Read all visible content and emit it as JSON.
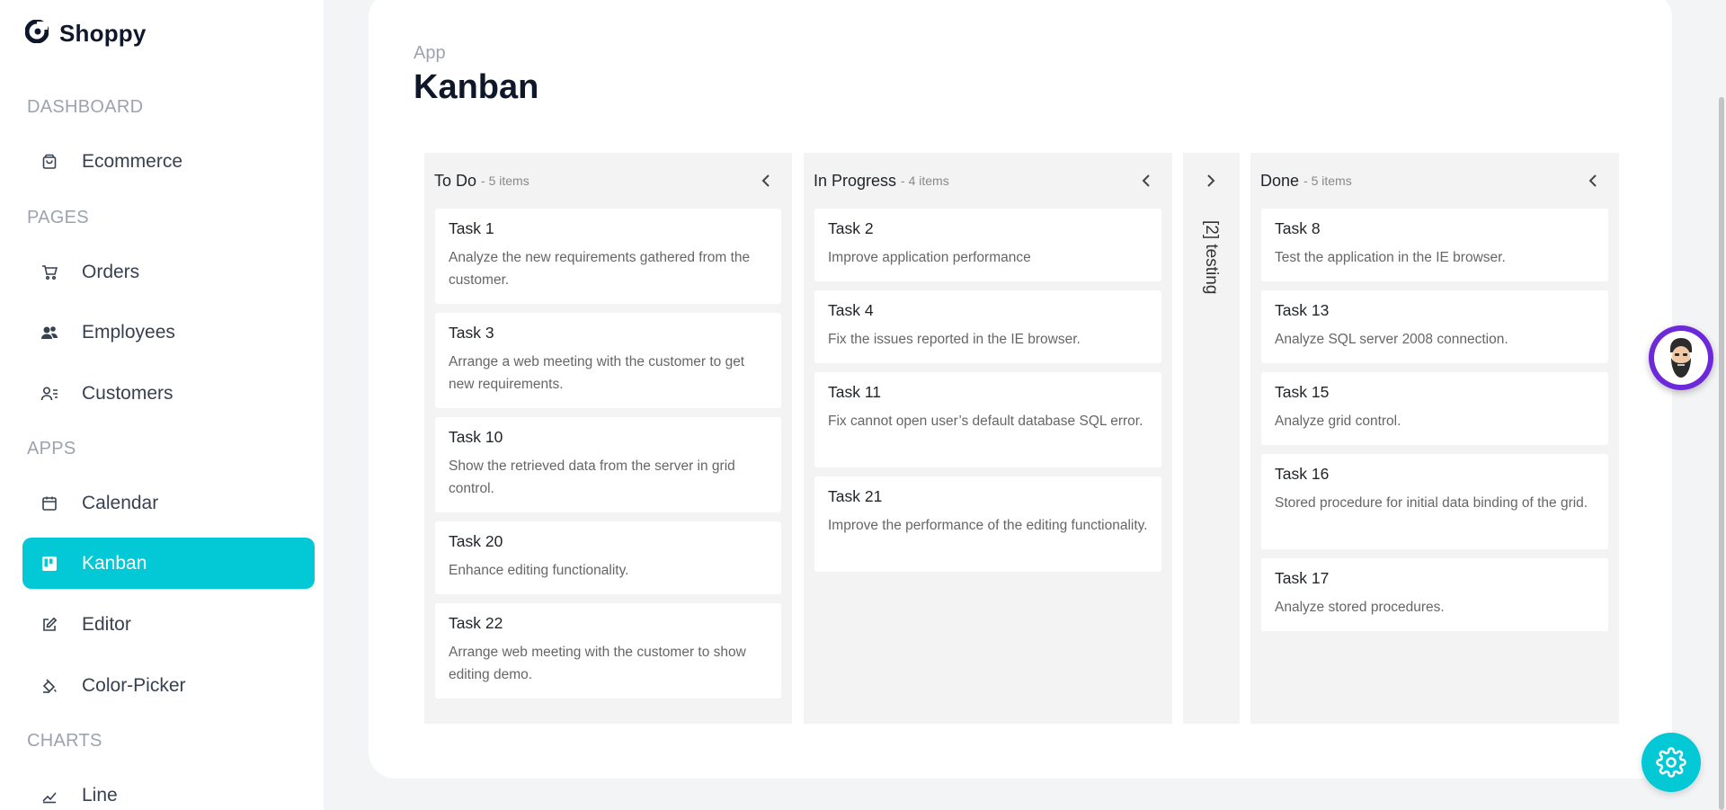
{
  "app": {
    "name": "Shoppy"
  },
  "sidebar": {
    "sections": [
      {
        "title": "DASHBOARD",
        "items": [
          {
            "label": "Ecommerce",
            "icon": "shopping-bag-icon"
          }
        ]
      },
      {
        "title": "PAGES",
        "items": [
          {
            "label": "Orders",
            "icon": "cart-icon"
          },
          {
            "label": "Employees",
            "icon": "users-icon"
          },
          {
            "label": "Customers",
            "icon": "contact-list-icon"
          }
        ]
      },
      {
        "title": "APPS",
        "items": [
          {
            "label": "Calendar",
            "icon": "calendar-icon"
          },
          {
            "label": "Kanban",
            "icon": "kanban-icon",
            "active": true
          },
          {
            "label": "Editor",
            "icon": "edit-icon"
          },
          {
            "label": "Color-Picker",
            "icon": "paint-bucket-icon"
          }
        ]
      },
      {
        "title": "CHARTS",
        "items": [
          {
            "label": "Line",
            "icon": "line-chart-icon"
          }
        ]
      }
    ]
  },
  "header": {
    "category": "App",
    "title": "Kanban"
  },
  "kanban": {
    "columns": [
      {
        "title": "To Do",
        "count": "- 5 items",
        "cards": [
          {
            "title": "Task 1",
            "text": "Analyze the new requirements gathered from the customer."
          },
          {
            "title": "Task 3",
            "text": "Arrange a web meeting with the customer to get new requirements."
          },
          {
            "title": "Task 10",
            "text": "Show the retrieved data from the server in grid control."
          },
          {
            "title": "Task 20",
            "text": "Enhance editing functionality."
          },
          {
            "title": "Task 22",
            "text": "Arrange web meeting with the customer to show editing demo."
          }
        ]
      },
      {
        "title": "In Progress",
        "count": "- 4 items",
        "cards": [
          {
            "title": "Task 2",
            "text": "Improve application performance"
          },
          {
            "title": "Task 4",
            "text": "Fix the issues reported in the IE browser."
          },
          {
            "title": "Task 11",
            "text": "Fix cannot open user’s default database SQL error."
          },
          {
            "title": "Task 21",
            "text": "Improve the performance of the editing functionality."
          }
        ]
      },
      {
        "title": "Done",
        "count": "- 5 items",
        "cards": [
          {
            "title": "Task 8",
            "text": "Test the application in the IE browser."
          },
          {
            "title": "Task 13",
            "text": "Analyze SQL server 2008 connection."
          },
          {
            "title": "Task 15",
            "text": "Analyze grid control."
          },
          {
            "title": "Task 16",
            "text": "Stored procedure for initial data binding of the grid."
          },
          {
            "title": "Task 17",
            "text": "Analyze stored procedures."
          }
        ]
      }
    ],
    "collapsed": {
      "label": "[2] testing"
    }
  },
  "floating": {
    "avatar_icon": "bearded-man-avatar-icon",
    "settings_icon": "gear-icon"
  },
  "colors": {
    "accent": "#03c9d7",
    "avatar_ring": "#6d28d9"
  }
}
